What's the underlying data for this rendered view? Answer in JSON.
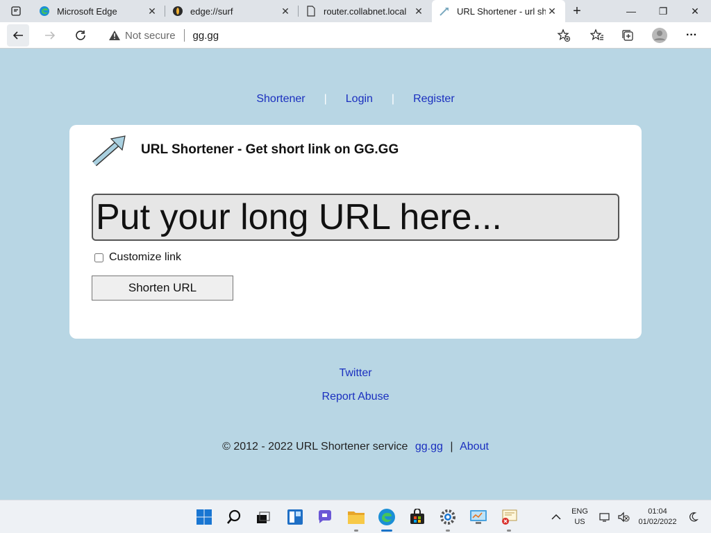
{
  "browser": {
    "tabs": [
      {
        "title": "Microsoft Edge",
        "icon": "edge-icon",
        "active": false
      },
      {
        "title": "edge://surf",
        "icon": "surf-icon",
        "active": false
      },
      {
        "title": "router.collabnet.local",
        "icon": "page-icon",
        "active": false
      },
      {
        "title": "URL Shortener - url sho",
        "icon": "arrow-favicon-icon",
        "active": true
      }
    ],
    "tab_close_glyph": "✕",
    "new_tab_glyph": "+",
    "window_controls": {
      "minimize": "—",
      "maximize": "❐",
      "close": "✕"
    },
    "address": {
      "security_label": "Not secure",
      "url": "gg.gg"
    },
    "more_glyph": "···"
  },
  "page": {
    "nav": {
      "shortener": "Shortener",
      "login": "Login",
      "register": "Register",
      "separator": "|"
    },
    "title": "URL Shortener - Get short link on GG.GG",
    "url_input_placeholder": "Put your long URL here...",
    "customize_label": "Customize link",
    "customize_checked": false,
    "shorten_button": "Shorten URL",
    "footer": {
      "twitter": "Twitter",
      "report": "Report Abuse",
      "copyright": "© 2012 - 2022 URL Shortener service",
      "site_link": "gg.gg",
      "separator": "|",
      "about": "About"
    }
  },
  "taskbar": {
    "apps": [
      "start-icon",
      "search-icon",
      "task-view-icon",
      "widgets-icon",
      "chat-icon",
      "file-explorer-icon",
      "edge-icon",
      "store-icon",
      "settings-icon",
      "control-panel-icon",
      "certificate-icon"
    ],
    "language": {
      "line1": "ENG",
      "line2": "US"
    },
    "time": "01:04",
    "date": "01/02/2022"
  },
  "colors": {
    "page_bg": "#b8d6e4",
    "link": "#1a2fbf",
    "card_bg": "#ffffff",
    "accent": "#1a73c8"
  }
}
